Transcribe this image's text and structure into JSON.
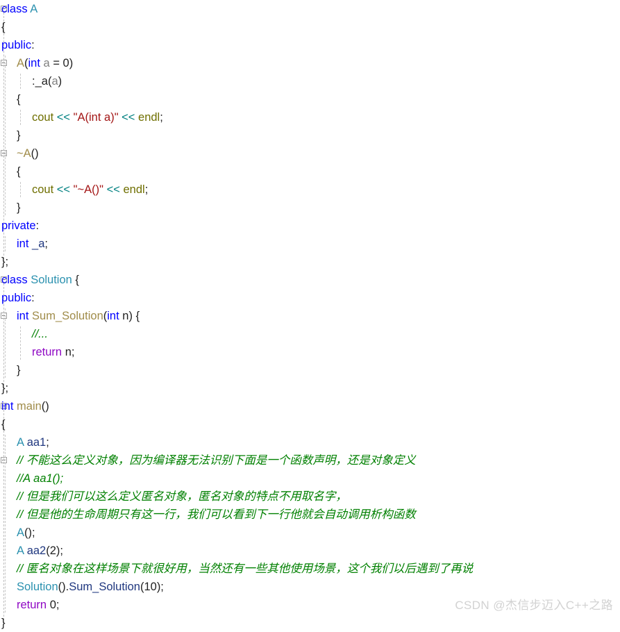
{
  "editor": {
    "language": "cpp",
    "background": "#ffffff",
    "line_height": 26,
    "font_size": 16.5,
    "colors": {
      "keyword": "#0000ff",
      "control_keyword": "#8f08c4",
      "type": "#2b91af",
      "function": "#a08c4a",
      "string": "#a31515",
      "operator": "#008080",
      "comment": "#008000",
      "variable": "#1f377f",
      "parameter": "#808080",
      "plain": "#1f1f1f",
      "stream_object": "#6f6f00",
      "indent_guide": "#c8c8c8",
      "fold_marker": "#a0a0a0"
    }
  },
  "lines": [
    {
      "indent": 0,
      "fold": true,
      "tokens": [
        {
          "t": "class",
          "c": "kw"
        },
        {
          "t": " ",
          "c": "plain"
        },
        {
          "t": "A",
          "c": "type"
        }
      ]
    },
    {
      "indent": 0,
      "fold": false,
      "tokens": [
        {
          "t": "{",
          "c": "plain"
        }
      ]
    },
    {
      "indent": 0,
      "fold": false,
      "tokens": [
        {
          "t": "public",
          "c": "kw"
        },
        {
          "t": ":",
          "c": "plain"
        }
      ]
    },
    {
      "indent": 1,
      "fold": true,
      "tokens": [
        {
          "t": "A",
          "c": "fn"
        },
        {
          "t": "(",
          "c": "plain"
        },
        {
          "t": "int",
          "c": "kw"
        },
        {
          "t": " ",
          "c": "plain"
        },
        {
          "t": "a",
          "c": "param"
        },
        {
          "t": " = ",
          "c": "plain"
        },
        {
          "t": "0",
          "c": "num"
        },
        {
          "t": ")",
          "c": "plain"
        }
      ]
    },
    {
      "indent": 2,
      "fold": false,
      "tokens": [
        {
          "t": ":",
          "c": "plain"
        },
        {
          "t": "_a",
          "c": "plain"
        },
        {
          "t": "(",
          "c": "plain"
        },
        {
          "t": "a",
          "c": "param"
        },
        {
          "t": ")",
          "c": "plain"
        }
      ]
    },
    {
      "indent": 1,
      "fold": false,
      "tokens": [
        {
          "t": "{",
          "c": "plain"
        }
      ]
    },
    {
      "indent": 2,
      "fold": false,
      "tokens": [
        {
          "t": "cout",
          "c": "obj"
        },
        {
          "t": " ",
          "c": "plain"
        },
        {
          "t": "<<",
          "c": "op"
        },
        {
          "t": " ",
          "c": "plain"
        },
        {
          "t": "\"A(int a)\"",
          "c": "str"
        },
        {
          "t": " ",
          "c": "plain"
        },
        {
          "t": "<<",
          "c": "op"
        },
        {
          "t": " ",
          "c": "plain"
        },
        {
          "t": "endl",
          "c": "obj"
        },
        {
          "t": ";",
          "c": "plain"
        }
      ]
    },
    {
      "indent": 1,
      "fold": false,
      "tokens": [
        {
          "t": "}",
          "c": "plain"
        }
      ]
    },
    {
      "indent": 1,
      "fold": true,
      "tokens": [
        {
          "t": "~A",
          "c": "fn"
        },
        {
          "t": "()",
          "c": "plain"
        }
      ]
    },
    {
      "indent": 1,
      "fold": false,
      "tokens": [
        {
          "t": "{",
          "c": "plain"
        }
      ]
    },
    {
      "indent": 2,
      "fold": false,
      "tokens": [
        {
          "t": "cout",
          "c": "obj"
        },
        {
          "t": " ",
          "c": "plain"
        },
        {
          "t": "<<",
          "c": "op"
        },
        {
          "t": " ",
          "c": "plain"
        },
        {
          "t": "\"~A()\"",
          "c": "str"
        },
        {
          "t": " ",
          "c": "plain"
        },
        {
          "t": "<<",
          "c": "op"
        },
        {
          "t": " ",
          "c": "plain"
        },
        {
          "t": "endl",
          "c": "obj"
        },
        {
          "t": ";",
          "c": "plain"
        }
      ]
    },
    {
      "indent": 1,
      "fold": false,
      "tokens": [
        {
          "t": "}",
          "c": "plain"
        }
      ]
    },
    {
      "indent": 0,
      "fold": false,
      "tokens": [
        {
          "t": "private",
          "c": "kw"
        },
        {
          "t": ":",
          "c": "plain"
        }
      ]
    },
    {
      "indent": 1,
      "fold": false,
      "tokens": [
        {
          "t": "int",
          "c": "kw"
        },
        {
          "t": " ",
          "c": "plain"
        },
        {
          "t": "_a",
          "c": "var"
        },
        {
          "t": ";",
          "c": "plain"
        }
      ]
    },
    {
      "indent": 0,
      "fold": false,
      "tokens": [
        {
          "t": "};",
          "c": "plain"
        }
      ]
    },
    {
      "indent": 0,
      "fold": true,
      "tokens": [
        {
          "t": "class",
          "c": "kw"
        },
        {
          "t": " ",
          "c": "plain"
        },
        {
          "t": "Solution",
          "c": "type"
        },
        {
          "t": " {",
          "c": "plain"
        }
      ]
    },
    {
      "indent": 0,
      "fold": false,
      "tokens": [
        {
          "t": "public",
          "c": "kw"
        },
        {
          "t": ":",
          "c": "plain"
        }
      ]
    },
    {
      "indent": 1,
      "fold": true,
      "tokens": [
        {
          "t": "int",
          "c": "kw"
        },
        {
          "t": " ",
          "c": "plain"
        },
        {
          "t": "Sum_Solution",
          "c": "fn"
        },
        {
          "t": "(",
          "c": "plain"
        },
        {
          "t": "int",
          "c": "kw"
        },
        {
          "t": " ",
          "c": "plain"
        },
        {
          "t": "n",
          "c": "plain"
        },
        {
          "t": ") {",
          "c": "plain"
        }
      ]
    },
    {
      "indent": 2,
      "fold": false,
      "tokens": [
        {
          "t": "//...",
          "c": "cmt"
        }
      ]
    },
    {
      "indent": 2,
      "fold": false,
      "tokens": [
        {
          "t": "return",
          "c": "ret"
        },
        {
          "t": " ",
          "c": "plain"
        },
        {
          "t": "n",
          "c": "plain"
        },
        {
          "t": ";",
          "c": "plain"
        }
      ]
    },
    {
      "indent": 1,
      "fold": false,
      "tokens": [
        {
          "t": "}",
          "c": "plain"
        }
      ]
    },
    {
      "indent": 0,
      "fold": false,
      "tokens": [
        {
          "t": "};",
          "c": "plain"
        }
      ]
    },
    {
      "indent": 0,
      "fold": true,
      "tokens": [
        {
          "t": "int",
          "c": "kw"
        },
        {
          "t": " ",
          "c": "plain"
        },
        {
          "t": "main",
          "c": "fn"
        },
        {
          "t": "()",
          "c": "plain"
        }
      ]
    },
    {
      "indent": 0,
      "fold": false,
      "tokens": [
        {
          "t": "{",
          "c": "plain"
        }
      ]
    },
    {
      "indent": 1,
      "fold": false,
      "tokens": [
        {
          "t": "A",
          "c": "type"
        },
        {
          "t": " ",
          "c": "plain"
        },
        {
          "t": "aa1",
          "c": "var"
        },
        {
          "t": ";",
          "c": "plain"
        }
      ]
    },
    {
      "indent": 1,
      "fold": true,
      "tokens": [
        {
          "t": "// 不能这么定义对象，因为编译器无法识别下面是一个函数声明，还是对象定义",
          "c": "cmt"
        }
      ]
    },
    {
      "indent": 1,
      "fold": false,
      "tokens": [
        {
          "t": "//A aa1();",
          "c": "cmt"
        }
      ]
    },
    {
      "indent": 1,
      "fold": false,
      "tokens": [
        {
          "t": "// 但是我们可以这么定义匿名对象，匿名对象的特点不用取名字，",
          "c": "cmt"
        }
      ]
    },
    {
      "indent": 1,
      "fold": false,
      "tokens": [
        {
          "t": "// 但是他的生命周期只有这一行，我们可以看到下一行他就会自动调用析构函数",
          "c": "cmt"
        }
      ]
    },
    {
      "indent": 1,
      "fold": false,
      "tokens": [
        {
          "t": "A",
          "c": "type"
        },
        {
          "t": "();",
          "c": "plain"
        }
      ]
    },
    {
      "indent": 1,
      "fold": false,
      "tokens": [
        {
          "t": "A",
          "c": "type"
        },
        {
          "t": " ",
          "c": "plain"
        },
        {
          "t": "aa2",
          "c": "var"
        },
        {
          "t": "(",
          "c": "plain"
        },
        {
          "t": "2",
          "c": "num"
        },
        {
          "t": ");",
          "c": "plain"
        }
      ]
    },
    {
      "indent": 1,
      "fold": false,
      "tokens": [
        {
          "t": "// 匿名对象在这样场景下就很好用，当然还有一些其他使用场景，这个我们以后遇到了再说",
          "c": "cmt"
        }
      ]
    },
    {
      "indent": 1,
      "fold": false,
      "tokens": [
        {
          "t": "Solution",
          "c": "type"
        },
        {
          "t": "().",
          "c": "plain"
        },
        {
          "t": "Sum_Solution",
          "c": "var"
        },
        {
          "t": "(",
          "c": "plain"
        },
        {
          "t": "10",
          "c": "num"
        },
        {
          "t": ");",
          "c": "plain"
        }
      ]
    },
    {
      "indent": 1,
      "fold": false,
      "tokens": [
        {
          "t": "return",
          "c": "ret"
        },
        {
          "t": " ",
          "c": "plain"
        },
        {
          "t": "0",
          "c": "num"
        },
        {
          "t": ";",
          "c": "plain"
        }
      ]
    },
    {
      "indent": 0,
      "fold": false,
      "tokens": [
        {
          "t": "}",
          "c": "plain"
        }
      ]
    }
  ],
  "watermark": {
    "text": "CSDN @杰信步迈入C++之路"
  }
}
